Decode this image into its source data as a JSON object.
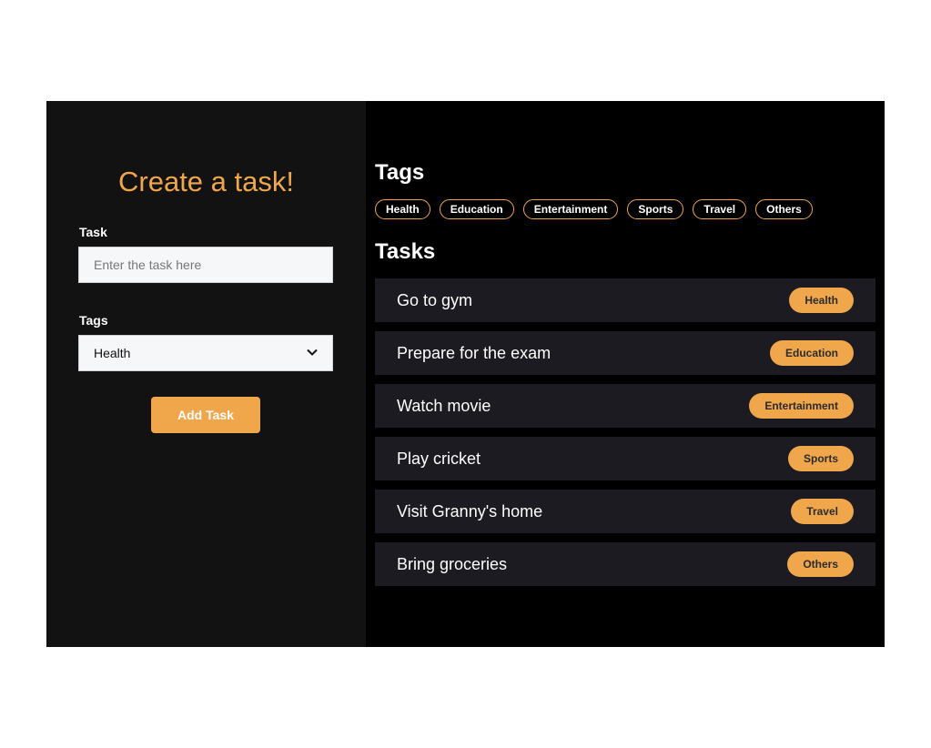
{
  "form": {
    "title": "Create a task!",
    "task_label": "Task",
    "task_placeholder": "Enter the task here",
    "task_value": "",
    "tags_label": "Tags",
    "tags_selected": "Health",
    "add_button_label": "Add Task"
  },
  "tags_section": {
    "title": "Tags",
    "tags": [
      "Health",
      "Education",
      "Entertainment",
      "Sports",
      "Travel",
      "Others"
    ]
  },
  "tasks_section": {
    "title": "Tasks",
    "tasks": [
      {
        "text": "Go to gym",
        "tag": "Health"
      },
      {
        "text": "Prepare for the exam",
        "tag": "Education"
      },
      {
        "text": "Watch movie",
        "tag": "Entertainment"
      },
      {
        "text": "Play cricket",
        "tag": "Sports"
      },
      {
        "text": "Visit Granny's home",
        "tag": "Travel"
      },
      {
        "text": "Bring groceries",
        "tag": "Others"
      }
    ]
  },
  "colors": {
    "accent": "#f0a64a",
    "left_panel_bg": "#121212",
    "right_panel_bg": "#000000",
    "card_bg": "#1c1b22"
  },
  "icons": {
    "select_arrow": "chevron-down-icon"
  }
}
